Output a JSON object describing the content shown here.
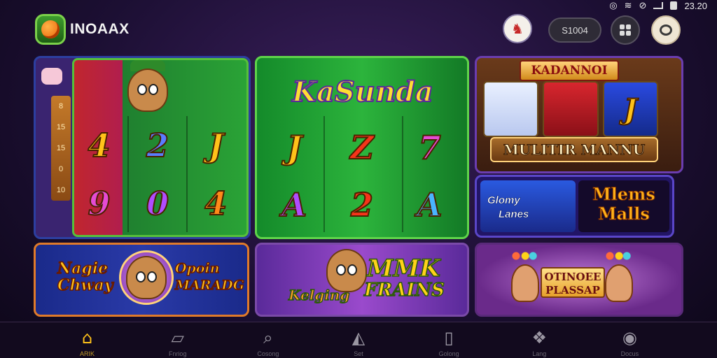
{
  "status_bar": {
    "time": "23.20"
  },
  "header": {
    "app_name": "INOAAX",
    "balance": "S1004",
    "avatar_icon": "player-avatar",
    "menu_icon": "grid-icon",
    "chat_icon": "chat-icon"
  },
  "games": {
    "game1": {
      "side_values": [
        "8",
        "15",
        "15",
        "0",
        "10"
      ],
      "reels": [
        "4",
        "2",
        "J",
        "9",
        "0",
        "4"
      ]
    },
    "game2": {
      "title": "KaSunda",
      "reels": [
        "J",
        "Z",
        "7",
        "A",
        "2",
        "A"
      ]
    },
    "game3": {
      "banner": "KADANNOI",
      "reel_symbol": "J",
      "name": "MULITIR MANNU"
    },
    "game4": {
      "left_line1": "Glomy",
      "left_line2": "Lanes",
      "right_line1": "Mlems",
      "right_line2": "Malls"
    },
    "game5": {
      "left_line1": "Nagie",
      "left_line2": "Chway",
      "right_line1": "Opoin",
      "right_line2": "MARADG"
    },
    "game6": {
      "line1": "MMK",
      "line2": "FRAINS",
      "script": "Kelging"
    },
    "game7": {
      "sign_line1": "OTINOEE",
      "sign_line2": "PLASSAP"
    }
  },
  "nav": {
    "items": [
      {
        "label": "ARIK",
        "icon": "home-icon"
      },
      {
        "label": "Fnriog",
        "icon": "card-icon"
      },
      {
        "label": "Cosong",
        "icon": "search-icon"
      },
      {
        "label": "Set",
        "icon": "play-icon"
      },
      {
        "label": "Golong",
        "icon": "wallet-icon"
      },
      {
        "label": "Lang",
        "icon": "gift-icon"
      },
      {
        "label": "Docus",
        "icon": "profile-icon"
      }
    ]
  },
  "colors": {
    "accent": "#ffc21a",
    "nav_background": "#120a1e",
    "page_background": "#1c0f33"
  }
}
